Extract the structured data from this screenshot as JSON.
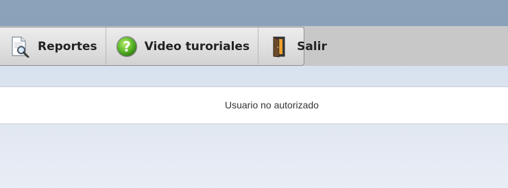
{
  "menu": {
    "items": [
      {
        "label": "Reportes",
        "icon": "report-search-icon"
      },
      {
        "label": "Video turoriales",
        "icon": "help-question-icon"
      },
      {
        "label": "Salir",
        "icon": "exit-door-icon"
      }
    ]
  },
  "message": {
    "text": "Usuario no autorizado"
  },
  "colors": {
    "banner": "#8aa3ba",
    "toolbar": "#c8c8c8",
    "content_background": "#e4eaf3",
    "help_icon_green": "#5cb82a"
  }
}
